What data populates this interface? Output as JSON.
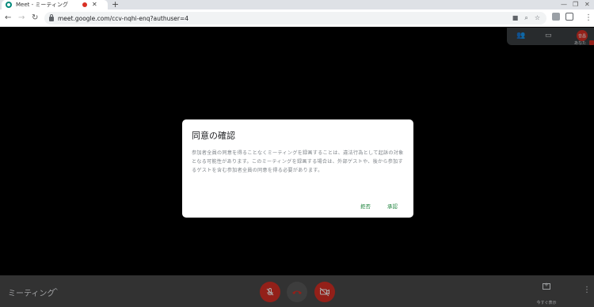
{
  "browser": {
    "tab_title": "Meet - ミーティング",
    "tab_close": "✕",
    "new_tab": "+",
    "url": "meet.google.com/ccv-nqhi-enq?authuser=4",
    "window_controls": {
      "minimize": "—",
      "restore": "❐",
      "close": "✕"
    }
  },
  "meet": {
    "avatar_initials": "音昌",
    "you_label": "あなた",
    "meeting_title": "ミーティング",
    "present_label": "今すぐ表示"
  },
  "dialog": {
    "title": "同意の確認",
    "body": "参加者全員の同意を得ることなくミーティングを録画することは、違法行為として起訴の対象となる可能性があります。このミーティングを録画する場合は、外部ゲストや、後から参加するゲストを含む参加者全員の同意を得る必要があります。",
    "decline_label": "拒否",
    "accept_label": "承認"
  },
  "colors": {
    "accent_green": "#188038",
    "meet_red": "#d93025"
  }
}
